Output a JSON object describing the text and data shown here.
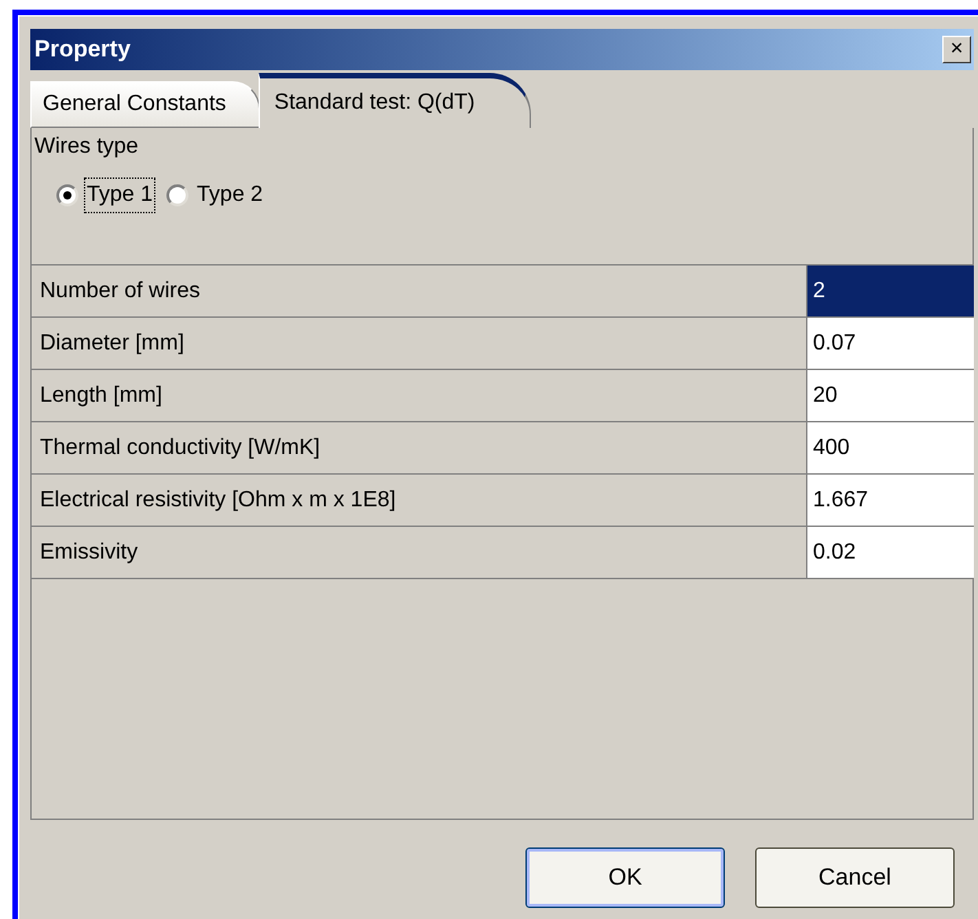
{
  "window": {
    "title": "Property",
    "close": "×"
  },
  "tabs": [
    {
      "label": "General Constants",
      "selected": false
    },
    {
      "label": "Standard test: Q(dT)",
      "selected": true
    }
  ],
  "wires_type": {
    "label": "Wires type",
    "options": [
      {
        "label": "Type 1",
        "selected": true,
        "focused": true
      },
      {
        "label": "Type 2",
        "selected": false,
        "focused": false
      }
    ]
  },
  "properties": [
    {
      "name": "Number of wires",
      "value": "2",
      "selected": true
    },
    {
      "name": "Diameter [mm]",
      "value": "0.07",
      "selected": false
    },
    {
      "name": "Length [mm]",
      "value": "20",
      "selected": false
    },
    {
      "name": "Thermal conductivity [W/mK]",
      "value": "400",
      "selected": false
    },
    {
      "name": "Electrical resistivity [Ohm x m x 1E8]",
      "value": "1.667",
      "selected": false
    },
    {
      "name": "Emissivity",
      "value": "0.02",
      "selected": false
    }
  ],
  "buttons": [
    {
      "label": "OK",
      "default": true
    },
    {
      "label": "Cancel",
      "default": false
    }
  ]
}
